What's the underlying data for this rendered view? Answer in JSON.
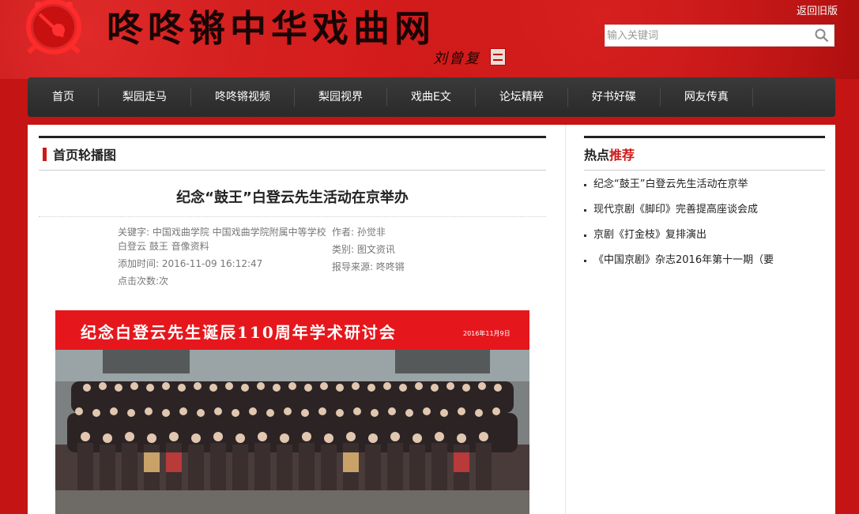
{
  "header": {
    "site_title": "咚咚锵中华戏曲网",
    "signature": "刘曾复",
    "back_link": "返回旧版",
    "search_placeholder": "输入关键词"
  },
  "nav": {
    "items": [
      "首页",
      "梨园走马",
      "咚咚锵视频",
      "梨园视界",
      "戏曲E文",
      "论坛精粹",
      "好书好碟",
      "网友传真"
    ]
  },
  "main": {
    "section_title": "首页轮播图",
    "article_title": "纪念“鼓王”白登云先生活动在京举办",
    "meta": {
      "keywords": "关键字: 中国戏曲学院 中国戏曲学院附属中等学校 白登云 鼓王 音像资料",
      "author": "作者: 孙觉非",
      "category": "类别: 图文资讯",
      "added_time": "添加时间: 2016-11-09 16:12:47",
      "source": "报导来源: 咚咚锵",
      "clicks": "点击次数:次"
    },
    "photo": {
      "banner_text": "纪念白登云先生诞辰110周年学术研讨会",
      "banner_date": "2016年11月9日"
    }
  },
  "sidebar": {
    "title_plain": "热点",
    "title_highlight": "推荐",
    "items": [
      "纪念“鼓王”白登云先生活动在京举",
      "现代京剧《脚印》完善提高座谈会成",
      "京剧《打金枝》复排演出",
      "《中国京剧》杂志2016年第十一期（要"
    ]
  },
  "colors": {
    "brand_red": "#c41414",
    "nav_dark": "#2f2f2f",
    "accent_red": "#d01818"
  }
}
